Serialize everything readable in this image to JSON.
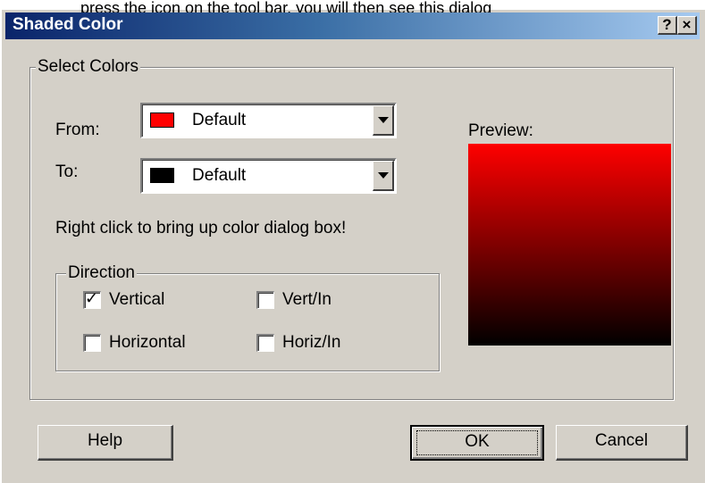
{
  "background_strip": {
    "text": "press the icon  on the tool bar, you will then see this dialog"
  },
  "window": {
    "title": "Shaded Color",
    "help_glyph": "?",
    "close_glyph": "×"
  },
  "select_colors": {
    "legend": "Select Colors",
    "from": {
      "label": "From:",
      "value": "Default",
      "swatch": "#ff0000"
    },
    "to": {
      "label": "To:",
      "value": "Default",
      "swatch": "#000000"
    },
    "hint": "Right click to bring up color dialog box!"
  },
  "direction": {
    "legend": "Direction",
    "options": [
      {
        "label": "Vertical",
        "checked": true
      },
      {
        "label": "Vert/In",
        "checked": false
      },
      {
        "label": "Horizontal",
        "checked": false
      },
      {
        "label": "Horiz/In",
        "checked": false
      }
    ]
  },
  "preview": {
    "label": "Preview:",
    "gradient_top": "#ff0000",
    "gradient_bottom": "#000000"
  },
  "buttons": {
    "help": "Help",
    "ok": "OK",
    "cancel": "Cancel"
  }
}
